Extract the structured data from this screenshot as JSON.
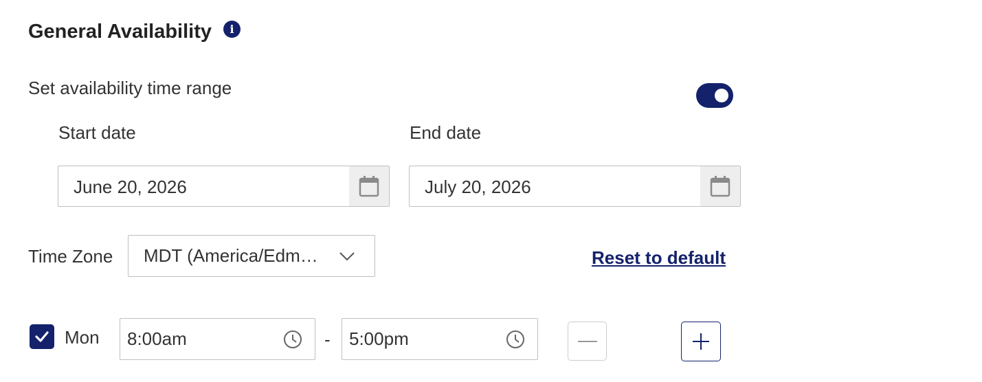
{
  "section": {
    "title": "General Availability",
    "info_icon": "info-icon",
    "info_glyph": "i"
  },
  "availability_range": {
    "label": "Set availability time range",
    "enabled": true,
    "toggle_color": "#14226b"
  },
  "start_date": {
    "label": "Start date",
    "value": "June 20, 2026",
    "icon": "calendar-icon"
  },
  "end_date": {
    "label": "End date",
    "value": "July 20, 2026",
    "icon": "calendar-icon"
  },
  "time_zone": {
    "label": "Time Zone",
    "value": "MDT (America/Edm…",
    "icon": "chevron-down-icon"
  },
  "reset_link": {
    "label": "Reset to default"
  },
  "schedule": [
    {
      "day": "Mon",
      "checked": true,
      "start": "8:00am",
      "separator": "-",
      "end": "5:00pm",
      "start_icon": "clock-icon",
      "end_icon": "clock-icon",
      "remove_icon": "minus-icon",
      "add_icon": "plus-icon"
    }
  ],
  "colors": {
    "accent": "#14226b",
    "text": "#333333",
    "border": "#bfbfbf",
    "icon_bg": "#eeeeee"
  }
}
